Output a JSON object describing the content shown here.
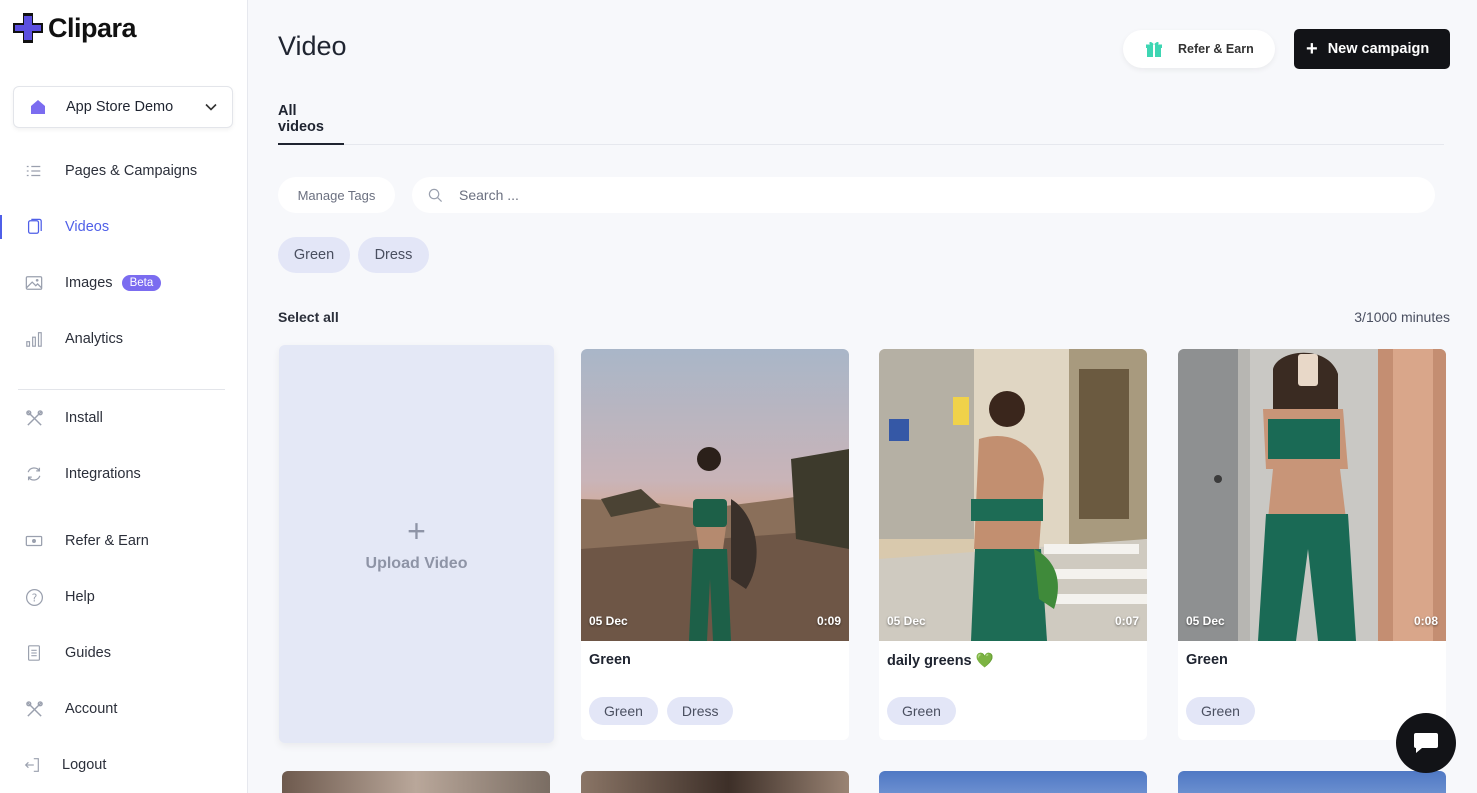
{
  "app": {
    "logo_text": "Clipara",
    "brand_color": "#5b4fe0"
  },
  "sidebar": {
    "workspace": {
      "name": "App Store Demo",
      "icon": "home-icon"
    },
    "items": [
      {
        "label": "Pages & Campaigns",
        "icon": "list-icon"
      },
      {
        "label": "Videos",
        "icon": "video-icon",
        "active": true
      },
      {
        "label": "Images",
        "icon": "image-icon",
        "badge": "Beta"
      },
      {
        "label": "Analytics",
        "icon": "bar-chart-icon"
      },
      {
        "label": "Install",
        "icon": "tools-icon"
      },
      {
        "label": "Integrations",
        "icon": "sync-icon"
      },
      {
        "label": "Refer & Earn",
        "icon": "money-icon"
      },
      {
        "label": "Help",
        "icon": "help-icon"
      },
      {
        "label": "Guides",
        "icon": "document-icon"
      },
      {
        "label": "Account",
        "icon": "tools-icon"
      },
      {
        "label": "Logout",
        "icon": "logout-icon"
      }
    ],
    "active_color": "#4f5fe8"
  },
  "header": {
    "title": "Video",
    "refer_label": "Refer & Earn",
    "new_campaign_label": "New campaign"
  },
  "tabs": [
    {
      "label": "All videos",
      "active": true
    }
  ],
  "toolbar": {
    "manage_tags_label": "Manage Tags",
    "search_placeholder": "Search ..."
  },
  "filter_tags": [
    "Green",
    "Dress"
  ],
  "list": {
    "select_all_label": "Select all",
    "minutes_used": "3/1000 minutes"
  },
  "upload": {
    "label": "Upload Video"
  },
  "videos": [
    {
      "date": "05 Dec",
      "duration": "0:09",
      "title": "Green",
      "emoji": "",
      "tags": [
        "Green",
        "Dress"
      ]
    },
    {
      "date": "05 Dec",
      "duration": "0:07",
      "title": "daily greens",
      "emoji": "💚",
      "tags": [
        "Green"
      ]
    },
    {
      "date": "05 Dec",
      "duration": "0:08",
      "title": "Green",
      "emoji": "",
      "tags": [
        "Green"
      ]
    }
  ]
}
